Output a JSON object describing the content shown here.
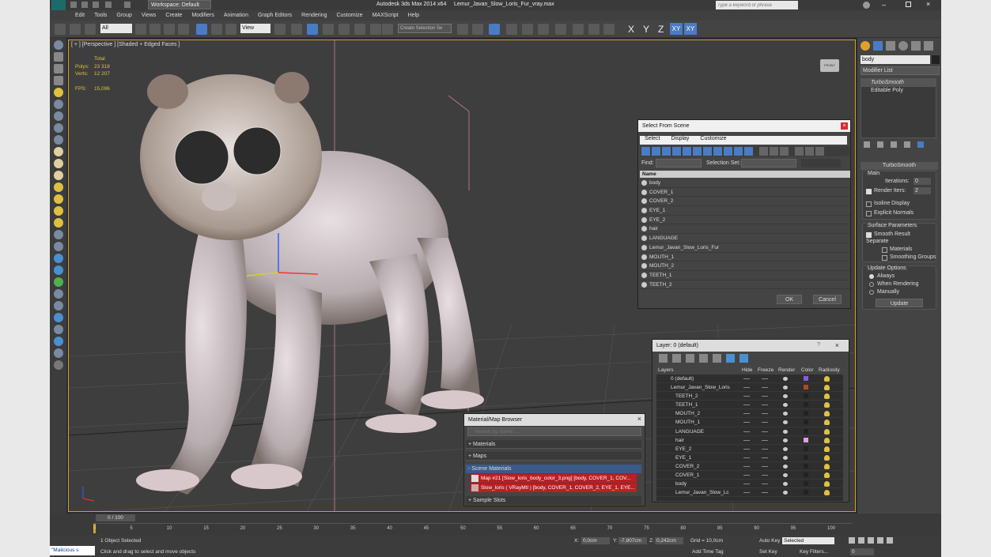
{
  "title_bar": {
    "app_title": "Autodesk 3ds Max  2014 x64",
    "file_name": "Lemur_Javan_Slow_Loris_Fur_vray.max",
    "workspace": "Workspace: Default",
    "search_placeholder": "Type a keyword or phrase"
  },
  "menu": {
    "items": [
      "Edit",
      "Tools",
      "Group",
      "Views",
      "Create",
      "Modifiers",
      "Animation",
      "Graph Editors",
      "Rendering",
      "Customize",
      "MAXScript",
      "Help"
    ]
  },
  "toolbar": {
    "filter": "All",
    "ref_coord": "View",
    "selection_set": "Create Selection Se",
    "axes": [
      "X",
      "Y",
      "Z",
      "XY",
      "XY"
    ]
  },
  "viewport": {
    "label": "[ + ] [Perspective ] [Shaded + Edged Faces ]",
    "stats": {
      "total_label": "Total",
      "polys_label": "Polys:",
      "polys_value": "23 318",
      "verts_label": "Verts:",
      "verts_value": "12 207",
      "fps_label": "FPS:",
      "fps_value": "15,096"
    },
    "viewcube_label": "FRONT"
  },
  "select_from_scene": {
    "title": "Select From Scene",
    "menus": [
      "Select",
      "Display",
      "Customize"
    ],
    "find_label": "Find:",
    "selection_set_label": "Selection Set:",
    "column_name": "Name",
    "items": [
      "body",
      "COVER_1",
      "COVER_2",
      "EYE_1",
      "EYE_2",
      "hair",
      "LANGUAGE",
      "Lemur_Javan_Slow_Loris_Fur",
      "MOUTH_1",
      "MOUTH_2",
      "TEETH_1",
      "TEETH_2"
    ],
    "ok": "OK",
    "cancel": "Cancel"
  },
  "layer_dialog": {
    "title": "Layer: 0 (default)",
    "columns": [
      "Layers",
      "Hide",
      "Freeze",
      "Render",
      "Color",
      "Radiosity"
    ],
    "rows": [
      {
        "name": "0 (default)",
        "color": "#8a5ad8"
      },
      {
        "name": "Lemur_Javan_Slow_Loris",
        "color": "#b04a20"
      },
      {
        "name": "TEETH_2",
        "color": "#222222"
      },
      {
        "name": "TEETH_1",
        "color": "#222222"
      },
      {
        "name": "MOUTH_2",
        "color": "#222222"
      },
      {
        "name": "MOUTH_1",
        "color": "#222222"
      },
      {
        "name": "LANGUAGE",
        "color": "#222222"
      },
      {
        "name": "hair",
        "color": "#e0a0e0"
      },
      {
        "name": "EYE_2",
        "color": "#222222"
      },
      {
        "name": "EYE_1",
        "color": "#222222"
      },
      {
        "name": "COVER_2",
        "color": "#222222"
      },
      {
        "name": "COVER_1",
        "color": "#222222"
      },
      {
        "name": "body",
        "color": "#222222"
      },
      {
        "name": "Lemur_Javan_Slow_Lc",
        "color": "#222222"
      }
    ]
  },
  "material_browser": {
    "title": "Material/Map Browser",
    "search_placeholder": "Search by Name ...",
    "sections": [
      "+ Materials",
      "+ Maps",
      "- Scene Materials",
      "+ Sample Slots"
    ],
    "scene_items": [
      "Map #21 [Slow_loris_body_color_3.png] [body, COVER_1, COV...",
      "Slow_loris  ( VRayMtl ) [body, COVER_1, COVER_2, EYE_1, EYE..."
    ]
  },
  "command_panel": {
    "object_name": "body",
    "modifier_list": "Modifier List",
    "stack": [
      "TurboSmooth",
      "Editable Poly"
    ],
    "turbosmooth": {
      "title": "TurboSmooth",
      "main_label": "Main",
      "iterations_label": "Iterations:",
      "iterations_value": "0",
      "render_iters_label": "Render Iters:",
      "render_iters_value": "2",
      "isoline": "Isoline Display",
      "explicit": "Explicit Normals",
      "surface_params": "Surface Parameters",
      "smooth_result": "Smooth Result",
      "separate": "Separate",
      "materials": "Materials",
      "smoothing_groups": "Smoothing Groups",
      "update_options": "Update Options",
      "always": "Always",
      "when_rendering": "When Rendering",
      "manually": "Manually",
      "update_btn": "Update"
    }
  },
  "timeline": {
    "frame_label": "0 / 100",
    "ticks": [
      "0",
      "5",
      "10",
      "15",
      "20",
      "25",
      "30",
      "35",
      "40",
      "45",
      "50",
      "55",
      "60",
      "65",
      "70",
      "75",
      "80",
      "85",
      "90",
      "95",
      "100"
    ]
  },
  "status": {
    "script_label": "\"Malicious s",
    "selected": "1 Object Selected",
    "prompt": "Click and drag to select and move objects",
    "x_label": "X:",
    "x_value": "0,0cm",
    "y_label": "Y:",
    "y_value": "-7,807cm",
    "z_label": "Z:",
    "z_value": "0,242cm",
    "grid": "Grid = 10,0cm",
    "auto_key": "Auto Key",
    "selected_dd": "Selected",
    "set_key": "Set Key",
    "key_filters": "Key Filters...",
    "add_time_tag": "Add Time Tag",
    "frame_value": "0"
  }
}
